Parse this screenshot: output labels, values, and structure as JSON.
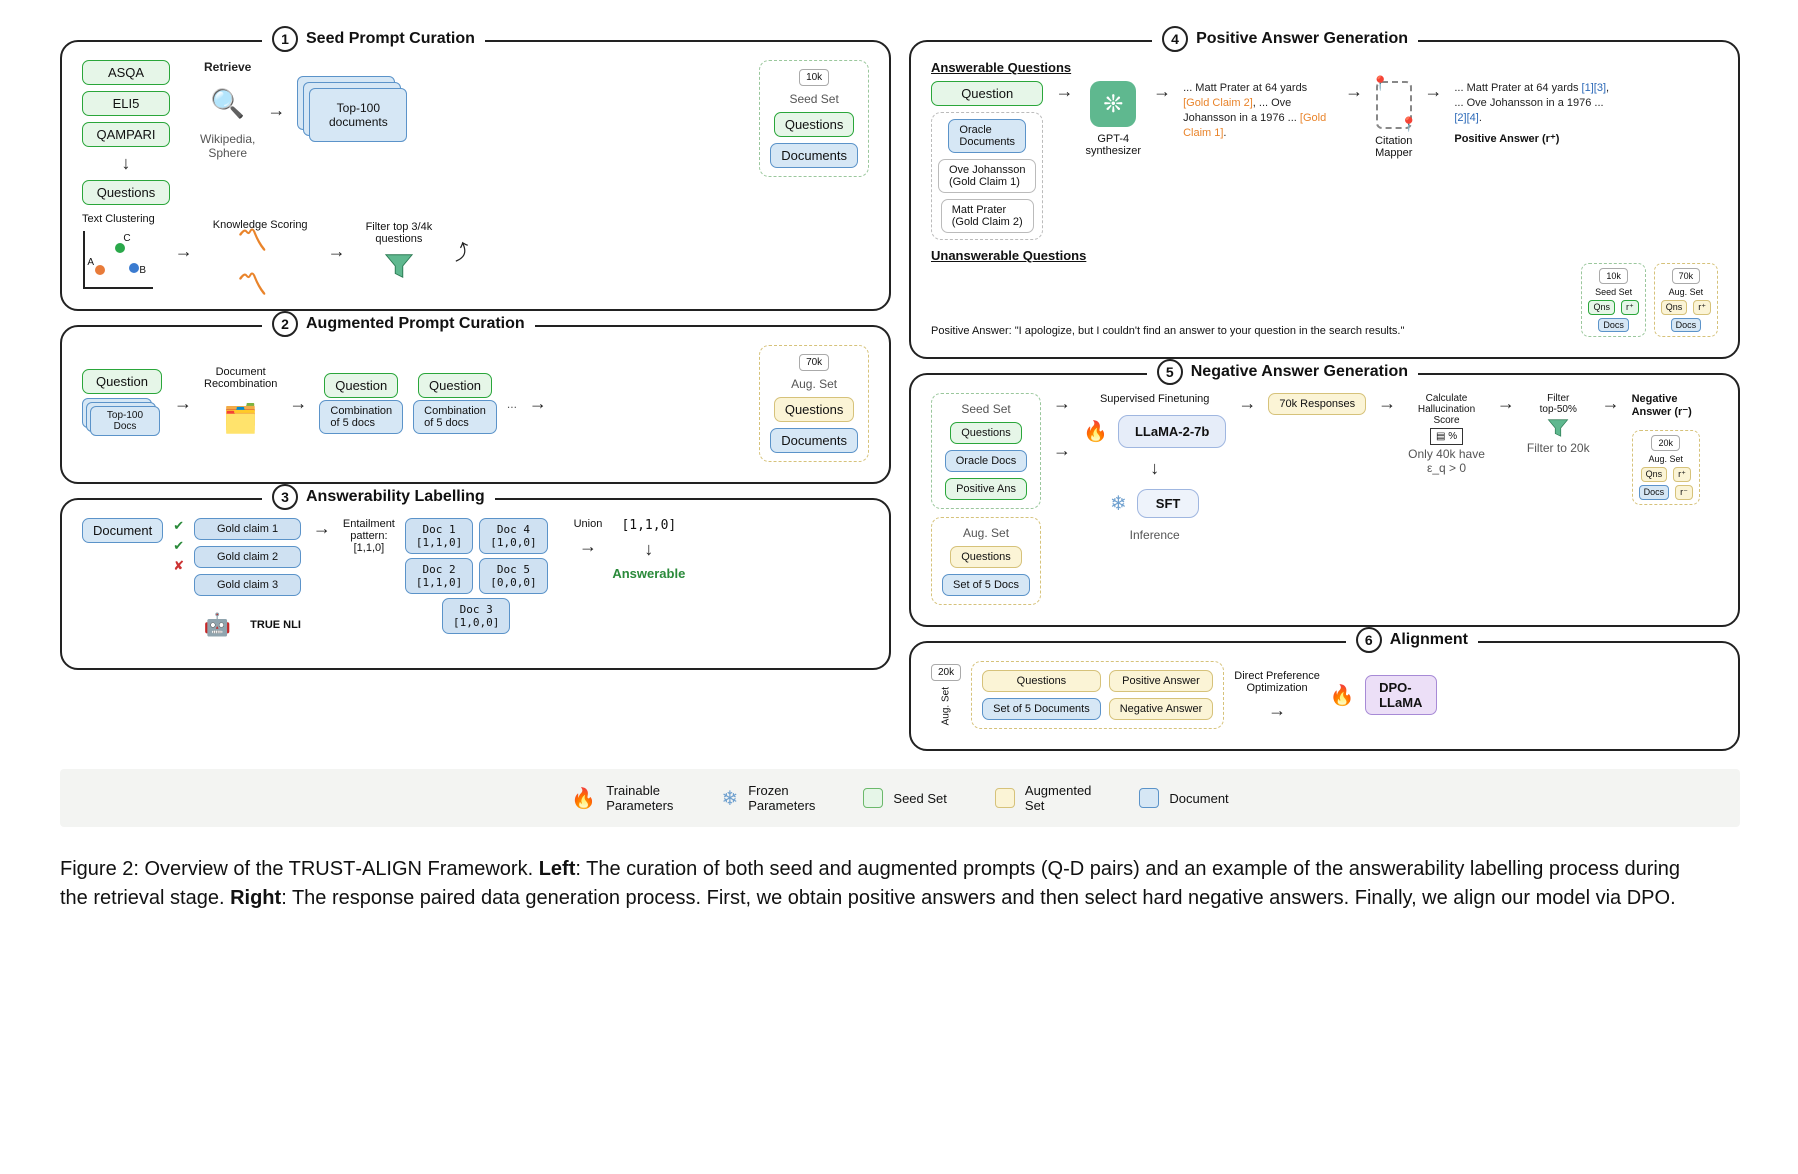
{
  "panels": {
    "p1": {
      "num": "1",
      "title": "Seed Prompt Curation"
    },
    "p2": {
      "num": "2",
      "title": "Augmented Prompt Curation"
    },
    "p3": {
      "num": "3",
      "title": "Answerability Labelling"
    },
    "p4": {
      "num": "4",
      "title": "Positive Answer Generation"
    },
    "p5": {
      "num": "5",
      "title": "Negative Answer Generation"
    },
    "p6": {
      "num": "6",
      "title": "Alignment"
    }
  },
  "p1": {
    "datasets": [
      "ASQA",
      "ELI5",
      "QAMPARI"
    ],
    "questions": "Questions",
    "retrieve": "Retrieve",
    "wikisphere": "Wikipedia,\nSphere",
    "top100": "Top-100\ndocuments",
    "textcluster": "Text Clustering",
    "clusterLabels": [
      "A",
      "B",
      "C"
    ],
    "knowscore": "Knowledge Scoring",
    "filter": "Filter top 3/4k\nquestions",
    "seed10k": "10k",
    "seedset": "Seed Set",
    "seedQ": "Questions",
    "seedD": "Documents"
  },
  "p2": {
    "question": "Question",
    "top100docs": "Top-100\nDocs",
    "docrecomb": "Document\nRecombination",
    "combo": "Combination\nof 5 docs",
    "ellipsis": "...",
    "aug70k": "70k",
    "augset": "Aug. Set",
    "augQ": "Questions",
    "augD": "Documents"
  },
  "p3": {
    "document": "Document",
    "claims": [
      "Gold claim 1",
      "Gold claim 2",
      "Gold claim 3"
    ],
    "entail": "Entailment\npattern:\n[1,1,0]",
    "docs": [
      {
        "name": "Doc 1",
        "pat": "[1,1,0]"
      },
      {
        "name": "Doc 2",
        "pat": "[1,1,0]"
      },
      {
        "name": "Doc 3",
        "pat": "[1,0,0]"
      },
      {
        "name": "Doc 4",
        "pat": "[1,0,0]"
      },
      {
        "name": "Doc 5",
        "pat": "[0,0,0]"
      }
    ],
    "truenli": "TRUE NLI",
    "union": "Union",
    "unionVec": "[1,1,0]",
    "answerable": "Answerable"
  },
  "p4": {
    "ansq": "Answerable Questions",
    "question": "Question",
    "oracle": "Oracle\nDocuments",
    "gold1": "Ove Johansson\n(Gold Claim 1)",
    "gold2": "Matt Prater\n(Gold Claim 2)",
    "gpt": "GPT-4\nsynthesizer",
    "txt1a": "... Matt Prater at 64 yards ",
    "txt1b": "[Gold Claim 2]",
    "txt1c": ", ... Ove Johansson in a 1976 ... ",
    "txt1d": "[Gold Claim 1]",
    "citmap": "Citation\nMapper",
    "txt2a": "... Matt Prater at 64 yards ",
    "txt2b": "[1][3]",
    "txt2c": ", ... Ove Johansson in a 1976 ...",
    "txt2d": "[2][4]",
    "posans": "Positive Answer (r⁺)",
    "unans": "Unanswerable Questions",
    "apology": "Positive Answer: \"I apologize, but I couldn't find an answer to your question in the search results.\"",
    "mini1": {
      "k": "10k",
      "set": "Seed Set",
      "qns": "Qns",
      "docs": "Docs",
      "r": "r⁺"
    },
    "mini2": {
      "k": "70k",
      "set": "Aug. Set",
      "qns": "Qns",
      "docs": "Docs",
      "r": "r⁺"
    }
  },
  "p5": {
    "seedset": "Seed Set",
    "seedQ": "Questions",
    "seedOD": "Oracle Docs",
    "seedPA": "Positive Ans",
    "augset": "Aug. Set",
    "augQ": "Questions",
    "augD": "Set of 5 Docs",
    "supFT": "Supervised Finetuning",
    "llama": "LLaMA-2-7b",
    "sft": "SFT",
    "inference": "Inference",
    "resp70k": "70k Responses",
    "hallu": "Calculate\nHallucination\nScore",
    "eq": "Only 40k have\nε_q > 0",
    "filterTop": "Filter\ntop-50%",
    "filter20k": "Filter to 20k",
    "neg": "Negative\nAnswer (r⁻)",
    "mini": {
      "k": "20k",
      "set": "Aug. Set",
      "qns": "Qns",
      "docs": "Docs",
      "rp": "r⁺",
      "rm": "r⁻"
    }
  },
  "p6": {
    "augset": "Aug. Set",
    "k": "20k",
    "q": "Questions",
    "d": "Set of 5 Documents",
    "pos": "Positive Answer",
    "neg": "Negative Answer",
    "dpo": "Direct Preference\nOptimization",
    "dpollama": "DPO-\nLLaMA"
  },
  "legend": {
    "train": "Trainable\nParameters",
    "frozen": "Frozen\nParameters",
    "seed": "Seed Set",
    "aug": "Augmented\nSet",
    "doc": "Document"
  },
  "caption": {
    "lead": "Figure 2:",
    "body1": " Overview of the T",
    "sc1": "RUST",
    "body1b": "-A",
    "sc2": "LIGN",
    "body2": " Framework. ",
    "left": "Left",
    "body3": ": The curation of both seed and augmented prompts (Q-D pairs) and an example of the answerability labelling process during the retrieval stage. ",
    "right": "Right",
    "body4": ": The response paired data generation process. First, we obtain positive answers and then select hard negative answers. Finally, we align our model via DPO."
  }
}
